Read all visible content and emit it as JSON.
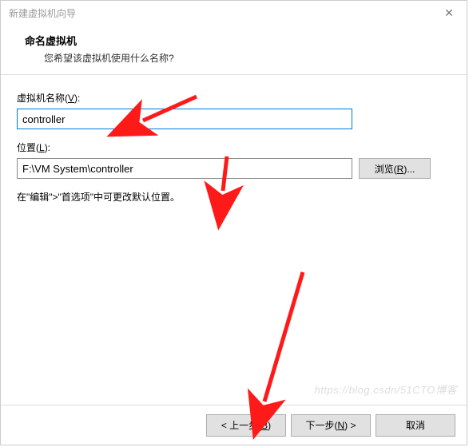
{
  "window": {
    "title": "新建虚拟机向导",
    "close_glyph": "✕"
  },
  "header": {
    "title": "命名虚拟机",
    "subtitle": "您希望该虚拟机使用什么名称?"
  },
  "fields": {
    "vm_name": {
      "label_pre": "虚拟机名称(",
      "label_key": "V",
      "label_post": "):",
      "value": "controller"
    },
    "location": {
      "label_pre": "位置(",
      "label_key": "L",
      "label_post": "):",
      "value": "F:\\VM System\\controller",
      "browse_pre": "浏览(",
      "browse_key": "R",
      "browse_post": ")..."
    }
  },
  "hint": "在\"编辑\">\"首选项\"中可更改默认位置。",
  "footer": {
    "back_pre": "< 上一步(",
    "back_key": "B",
    "back_post": ")",
    "next_pre": "下一步(",
    "next_key": "N",
    "next_post": ") >",
    "cancel": "取消"
  },
  "watermark": "https://blog.csdn/51CTO博客",
  "annotations": {
    "arrow_color": "#ff1a1a"
  }
}
